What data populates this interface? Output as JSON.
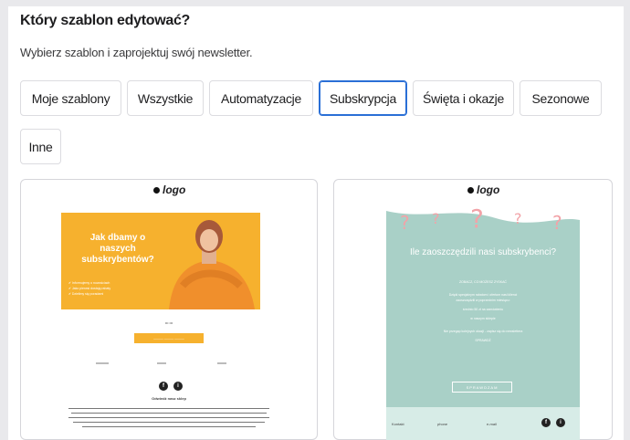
{
  "header": {
    "title": "Który szablon edytować?",
    "subtitle": "Wybierz szablon i zaprojektuj swój newsletter."
  },
  "tabs": [
    {
      "label": "Moje szablony",
      "active": false
    },
    {
      "label": "Wszystkie",
      "active": false
    },
    {
      "label": "Automatyzacje",
      "active": false
    },
    {
      "label": "Subskrypcja",
      "active": true
    },
    {
      "label": "Święta i okazje",
      "active": false
    },
    {
      "label": "Sezonowe",
      "active": false
    },
    {
      "label": "Inne",
      "active": false
    }
  ],
  "templates": [
    {
      "logo": "logo",
      "headline": "Jak dbamy o naszych subskrybentów?",
      "bullets": [
        "Informujemy o nowościach",
        "Jako pierwsi dostają rabaty",
        "Dzielimy się poradami"
      ],
      "footer_heading": "Odwiedź nasz sklep",
      "social": [
        "f",
        "i"
      ]
    },
    {
      "logo": "logo",
      "headline": "Ile zaoszczędzili nasi subskrybenci?",
      "lines": [
        "ZOBACZ, CO MOŻESZ ZYSKAĆ",
        "Dzięki specjalnym rabatom i ofertom nasi klienci",
        "zaoszczędzili w poprzednim miesiącu:",
        "średnio 50 zł na zamówieniu",
        "w naszym sklepie",
        "Nie przegap kolejnych okazji - zapisz się do newslettera",
        "SPRAWDŹ"
      ],
      "button": "SPRAWDZAM",
      "footer": [
        "Kontakt",
        "phone",
        "e-mail"
      ],
      "social": [
        "f",
        "i"
      ]
    }
  ],
  "colors": {
    "accent": "#2a6fd6",
    "orange": "#f6b12e",
    "teal": "#a9d0c7",
    "pink": "#f2a3a8"
  }
}
